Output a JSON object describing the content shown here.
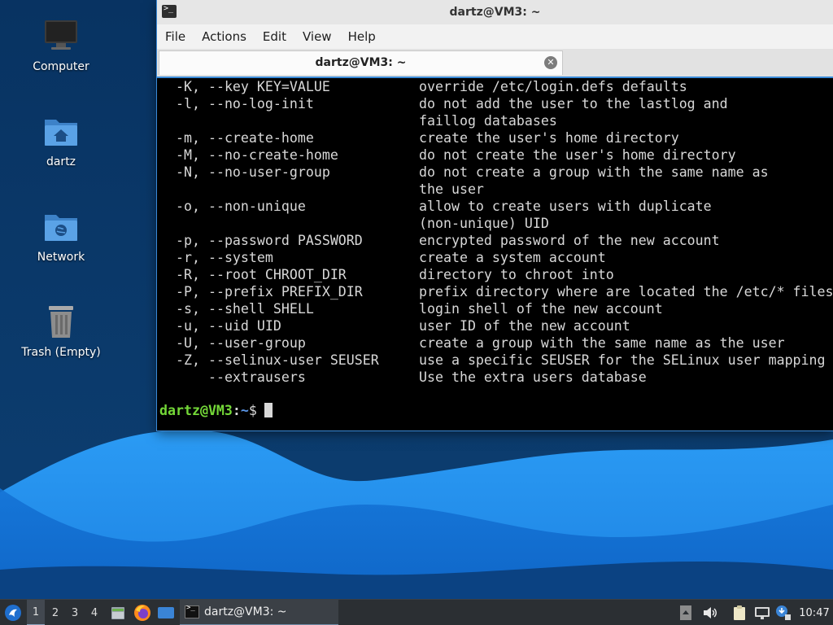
{
  "desktop": {
    "icons": [
      {
        "label": "Computer",
        "icon": "computer-icon"
      },
      {
        "label": "dartz",
        "icon": "home-folder-icon"
      },
      {
        "label": "Network",
        "icon": "network-folder-icon"
      },
      {
        "label": "Trash (Empty)",
        "icon": "trash-icon"
      }
    ]
  },
  "window": {
    "title": "dartz@VM3: ~",
    "menu": [
      "File",
      "Actions",
      "Edit",
      "View",
      "Help"
    ],
    "tab": {
      "label": "dartz@VM3: ~"
    },
    "terminal": {
      "lines": [
        {
          "opt": "-K, --key KEY=VALUE",
          "desc": "override /etc/login.defs defaults"
        },
        {
          "opt": "-l, --no-log-init",
          "desc": "do not add the user to the lastlog and"
        },
        {
          "opt": "",
          "desc": "faillog databases"
        },
        {
          "opt": "-m, --create-home",
          "desc": "create the user's home directory"
        },
        {
          "opt": "-M, --no-create-home",
          "desc": "do not create the user's home directory"
        },
        {
          "opt": "-N, --no-user-group",
          "desc": "do not create a group with the same name as"
        },
        {
          "opt": "",
          "desc": "the user"
        },
        {
          "opt": "-o, --non-unique",
          "desc": "allow to create users with duplicate"
        },
        {
          "opt": "",
          "desc": "(non-unique) UID"
        },
        {
          "opt": "-p, --password PASSWORD",
          "desc": "encrypted password of the new account"
        },
        {
          "opt": "-r, --system",
          "desc": "create a system account"
        },
        {
          "opt": "-R, --root CHROOT_DIR",
          "desc": "directory to chroot into"
        },
        {
          "opt": "-P, --prefix PREFIX_DIR",
          "desc": "prefix directory where are located the /etc/* files"
        },
        {
          "opt": "-s, --shell SHELL",
          "desc": "login shell of the new account"
        },
        {
          "opt": "-u, --uid UID",
          "desc": "user ID of the new account"
        },
        {
          "opt": "-U, --user-group",
          "desc": "create a group with the same name as the user"
        },
        {
          "opt": "-Z, --selinux-user SEUSER",
          "desc": "use a specific SEUSER for the SELinux user mapping"
        },
        {
          "opt": "    --extrausers",
          "desc": "Use the extra users database"
        }
      ],
      "prompt": {
        "user": "dartz@VM3",
        "colon": ":",
        "path": "~",
        "symbol": "$"
      }
    }
  },
  "taskbar": {
    "workspaces": [
      "1",
      "2",
      "3",
      "4"
    ],
    "active_workspace": "1",
    "launchers": [
      "files-icon",
      "firefox-icon",
      "show-desktop-icon"
    ],
    "task": {
      "label": "dartz@VM3: ~",
      "icon": "terminal-icon"
    },
    "tray": [
      "pager-icon",
      "volume-icon",
      "clipboard-icon",
      "network-icon",
      "updates-icon"
    ],
    "clock": "10:47"
  },
  "colors": {
    "accent": "#3a8ad8",
    "prompt_user": "#74d838",
    "prompt_path": "#5a96e8",
    "taskbar": "#2b2f33"
  }
}
